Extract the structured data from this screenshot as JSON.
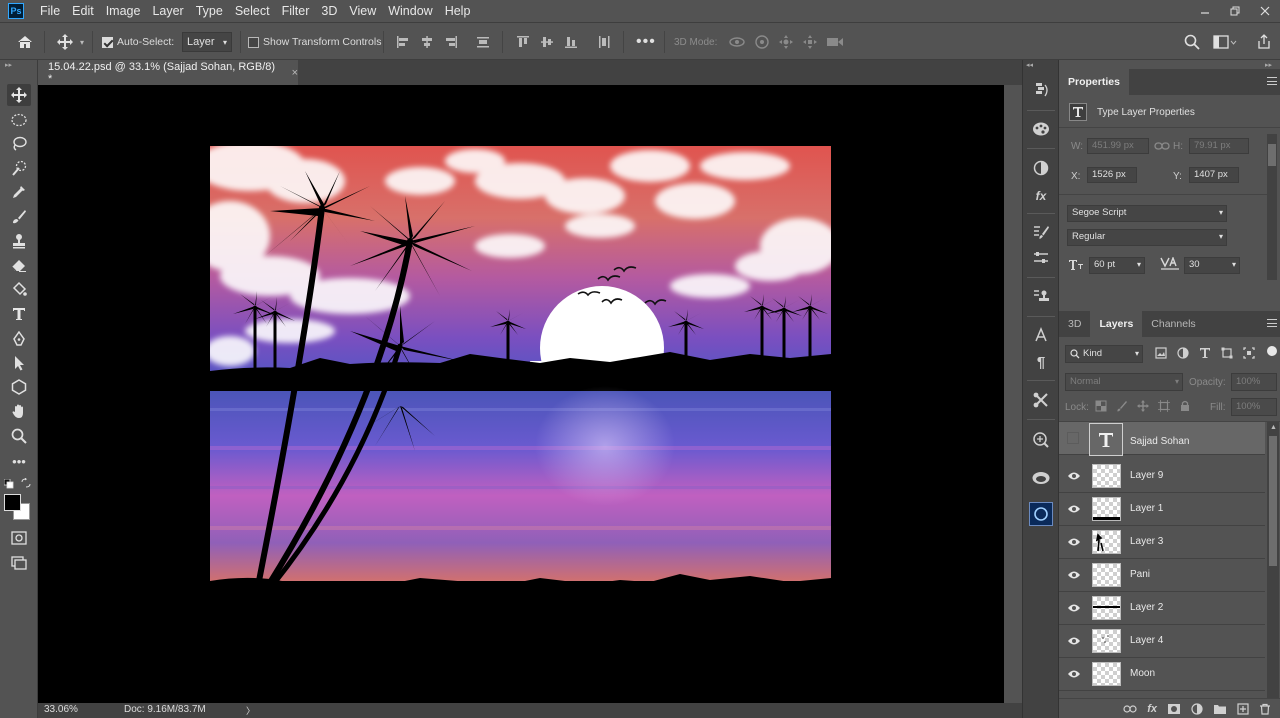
{
  "app": {
    "logo_text": "Ps"
  },
  "menu": [
    "File",
    "Edit",
    "Image",
    "Layer",
    "Type",
    "Select",
    "Filter",
    "3D",
    "View",
    "Window",
    "Help"
  ],
  "options_bar": {
    "auto_select_label": "Auto-Select:",
    "auto_select_checked": true,
    "auto_select_target": "Layer",
    "show_transform_label": "Show Transform Controls",
    "show_transform_checked": false,
    "mode_3d_label": "3D Mode:"
  },
  "document": {
    "tab_title": "15.04.22.psd @ 33.1% (Sajjad Sohan, RGB/8) *",
    "close_glyph": "×"
  },
  "status": {
    "zoom": "33.06%",
    "doc_size": "Doc: 9.16M/83.7M",
    "arrow": "〉"
  },
  "properties": {
    "tab": "Properties",
    "type_label": "Type Layer Properties",
    "w_label": "W:",
    "w_value": "451.99 px",
    "h_label": "H:",
    "h_value": "79.91 px",
    "x_label": "X:",
    "x_value": "1526 px",
    "y_label": "Y:",
    "y_value": "1407 px",
    "font_family": "Segoe Script",
    "font_style": "Regular",
    "font_size": "60 pt",
    "tracking": "30"
  },
  "layers_panel": {
    "tabs": [
      "3D",
      "Layers",
      "Channels"
    ],
    "active_tab": "Layers",
    "filter_kind": "Kind",
    "blend_mode": "Normal",
    "opacity_label": "Opacity:",
    "opacity_value": "100%",
    "lock_label": "Lock:",
    "fill_label": "Fill:",
    "fill_value": "100%",
    "layers": [
      {
        "name": "Sajjad Sohan",
        "type": "text",
        "visible": false,
        "selected": true
      },
      {
        "name": "Layer 9",
        "type": "pixel",
        "visible": true,
        "selected": false
      },
      {
        "name": "Layer 1",
        "type": "pixel",
        "visible": true,
        "selected": false
      },
      {
        "name": "Layer 3",
        "type": "pixel",
        "visible": true,
        "selected": false
      },
      {
        "name": "Pani",
        "type": "pixel",
        "visible": true,
        "selected": false
      },
      {
        "name": "Layer 2",
        "type": "pixel",
        "visible": true,
        "selected": false
      },
      {
        "name": "Layer 4",
        "type": "pixel",
        "visible": true,
        "selected": false
      },
      {
        "name": "Moon",
        "type": "pixel",
        "visible": true,
        "selected": false
      }
    ]
  },
  "colors": {
    "ui_bg": "#535353",
    "ui_dark": "#424242",
    "selected_layer": "#676767",
    "canvas_bg": "#000000",
    "sky_top": "#e0544f",
    "sky_mid": "#b45aa0",
    "sky_low": "#6a4bc8",
    "water_top": "#4b55b8",
    "water_bottom": "#d07070"
  }
}
